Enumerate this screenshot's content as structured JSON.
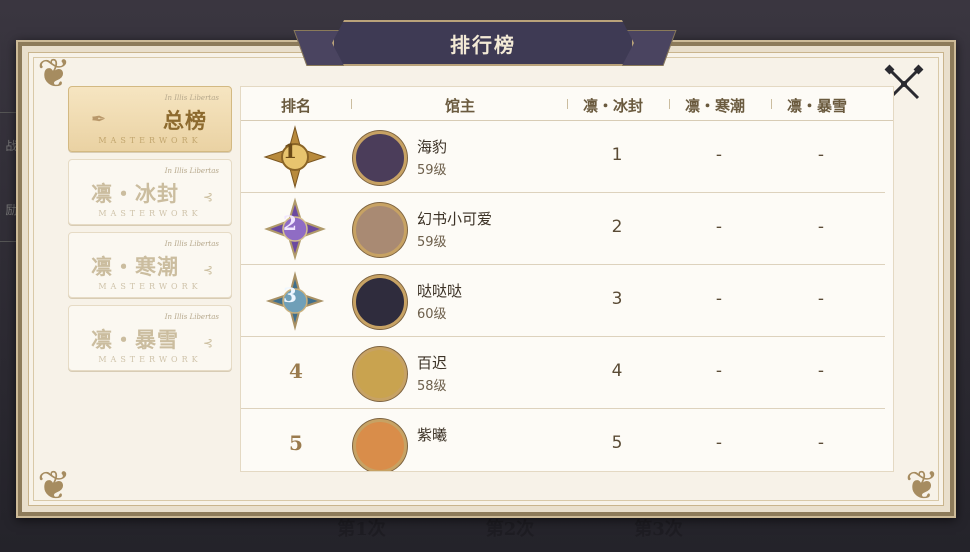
{
  "dialog": {
    "title": "排行榜"
  },
  "tabs": [
    {
      "label": "总榜",
      "small": "In Illis Libertas",
      "mark": "MASTERWORK",
      "active": true
    },
    {
      "label": "凛・冰封",
      "small": "In Illis Libertas",
      "mark": "MASTERWORK",
      "active": false
    },
    {
      "label": "凛・寒潮",
      "small": "In Illis Libertas",
      "mark": "MASTERWORK",
      "active": false
    },
    {
      "label": "凛・暴雪",
      "small": "In Illis Libertas",
      "mark": "MASTERWORK",
      "active": false
    }
  ],
  "table": {
    "headers": [
      "排名",
      "馆主",
      "凛・冰封",
      "凛・寒潮",
      "凛・暴雪"
    ],
    "rows": [
      {
        "rank": "1",
        "name": "海豹",
        "level": "59级",
        "c1": "1",
        "c2": "-",
        "c3": "-",
        "badge": "gold",
        "avatar_color": "#4b3d5a"
      },
      {
        "rank": "2",
        "name": "幻书小可爱",
        "level": "59级",
        "c1": "2",
        "c2": "-",
        "c3": "-",
        "badge": "purple",
        "avatar_color": "#a98a73"
      },
      {
        "rank": "3",
        "name": "哒哒哒",
        "level": "60级",
        "c1": "3",
        "c2": "-",
        "c3": "-",
        "badge": "blue",
        "avatar_color": "#2f2c3d"
      },
      {
        "rank": "4",
        "name": "百迟",
        "level": "58级",
        "c1": "4",
        "c2": "-",
        "c3": "-",
        "badge": "none",
        "avatar_color": "#c9a34f"
      },
      {
        "rank": "5",
        "name": "紫曦",
        "level": "",
        "c1": "5",
        "c2": "-",
        "c3": "-",
        "badge": "none",
        "avatar_color": "#d98d4a"
      }
    ]
  },
  "background": {
    "ghost_labels": [
      "第1次",
      "第2次",
      "第3次"
    ],
    "side_labels": [
      "战",
      "励"
    ]
  },
  "colors": {
    "gold": "#c9a14a",
    "purple": "#6b4aa0",
    "blue": "#3f6f8c",
    "banner": "#3e3a54"
  },
  "icons": {
    "close": "crossed-swords-close-icon",
    "badge1": "rank-gold-star-icon",
    "badge2": "rank-purple-star-icon",
    "badge3": "rank-blue-star-icon"
  }
}
